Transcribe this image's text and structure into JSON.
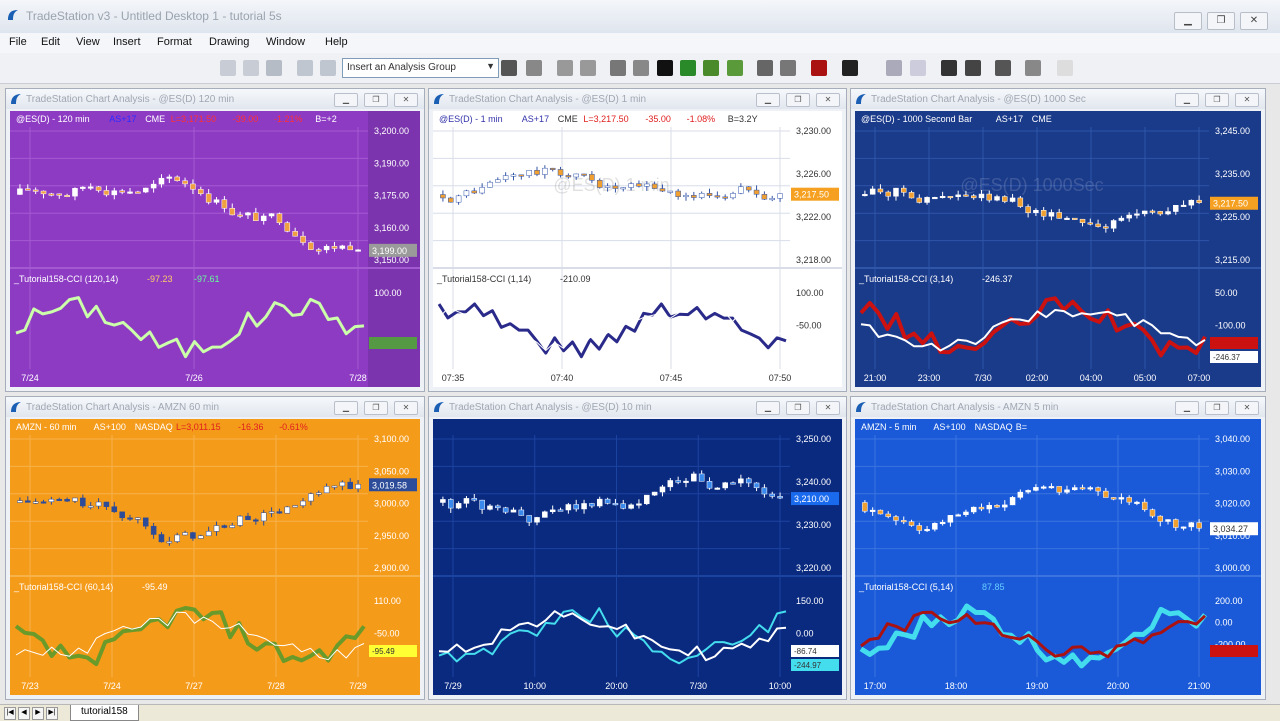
{
  "window": {
    "title": "TradeStation v3 - Untitled Desktop 1 - tutorial 5s"
  },
  "menu": [
    "File",
    "Edit",
    "View",
    "Insert",
    "Format",
    "Drawing",
    "Window",
    "Help"
  ],
  "toolbar": {
    "analysis_group": "Insert an Analysis Group"
  },
  "windows": [
    {
      "title": "TradeStation Chart Analysis - @ES(D) 120 min",
      "bg": "#8e3bc4",
      "panel": "#6b2a96",
      "axisbg": "#7b34ad",
      "fg": "#ffffff",
      "grid": "#a35ad0",
      "header": [
        {
          "t": "@ES(D) - 120 min",
          "c": "#ffffff"
        },
        {
          "t": "AS+17",
          "c": "#2b2bff"
        },
        {
          "t": "CME",
          "c": "#ffffff"
        },
        {
          "t": "L=3,171.50",
          "c": "#ff3030"
        },
        {
          "t": "-39.00",
          "c": "#ff3030"
        },
        {
          "t": "-1.21%",
          "c": "#ff3030"
        },
        {
          "t": "B=+2",
          "c": "#ffffff"
        }
      ],
      "yticks": [
        "3,200.00",
        "3,190.00",
        "3,175.00",
        "3,160.00",
        "3,150.00"
      ],
      "price_tags": [
        {
          "t": "3,199.00",
          "bg": "#9a9a9a",
          "c": "#ffffff"
        }
      ],
      "ind_label": "_Tutorial158-CCI (120,14)",
      "ind_values": [
        {
          "t": "-97.23",
          "c": "#ffcc66"
        },
        {
          "t": "-97.61",
          "c": "#66ff99"
        }
      ],
      "ind_ticks": [
        "100.00"
      ],
      "ind_tags": [
        {
          "t": "",
          "bg": "#559944",
          "c": "#ffffff"
        }
      ],
      "xticks": [
        "7/24",
        "7/26",
        "7/28"
      ],
      "candle_up": "#ffffff",
      "candle_dn": "#f0a040",
      "wick": "#ffffff",
      "lines": [
        {
          "color": "#ccffaa",
          "w": 3
        }
      ]
    },
    {
      "title": "TradeStation Chart Analysis - @ES(D) 1 min",
      "bg": "#ffffff",
      "panel": "#ffffff",
      "axisbg": "#ffffff",
      "fg": "#333333",
      "grid": "#d8dde8",
      "header": [
        {
          "t": "@ES(D) - 1 min",
          "c": "#3333aa"
        },
        {
          "t": "AS+17",
          "c": "#3333aa"
        },
        {
          "t": "CME",
          "c": "#333333"
        },
        {
          "t": "L=3,217.50",
          "c": "#e02020"
        },
        {
          "t": "-35.00",
          "c": "#e02020"
        },
        {
          "t": "-1.08%",
          "c": "#e02020"
        },
        {
          "t": "B=3.2Y",
          "c": "#333333"
        }
      ],
      "yticks": [
        "3,230.00",
        "3,226.00",
        "3,222.00",
        "3,218.00"
      ],
      "price_tags": [
        {
          "t": "3,217.50",
          "bg": "#f5a020",
          "c": "#ffffff"
        }
      ],
      "watermark": "@ES(D) 1 min",
      "ind_label": "_Tutorial158-CCI (1,14)",
      "ind_values": [
        {
          "t": "-210.09",
          "c": "#333333"
        }
      ],
      "ind_ticks": [
        "100.00",
        "-50.00"
      ],
      "ind_tags": [],
      "xticks": [
        "07:35",
        "07:40",
        "07:45",
        "07:50"
      ],
      "candle_up": "#ffffff",
      "candle_dn": "#f0a030",
      "wick": "#3355aa",
      "lines": [
        {
          "color": "#2a2a8a",
          "w": 3
        },
        {
          "color": "#ffffff",
          "w": 1
        }
      ]
    },
    {
      "title": "TradeStation Chart Analysis - @ES(D) 1000 Sec",
      "bg": "#1a3a8a",
      "panel": "#16307a",
      "axisbg": "#1a3a8a",
      "fg": "#ffffff",
      "grid": "#2f55a8",
      "header": [
        {
          "t": "@ES(D) - 1000 Second Bar",
          "c": "#ffffff"
        },
        {
          "t": "AS+17",
          "c": "#ffffff"
        },
        {
          "t": "CME",
          "c": "#ffffff"
        }
      ],
      "yticks": [
        "3,245.00",
        "3,235.00",
        "3,225.00",
        "3,215.00"
      ],
      "price_tags": [
        {
          "t": "3,217.50",
          "bg": "#f5a020",
          "c": "#ffffff"
        }
      ],
      "watermark": "@ES(D) 1000Sec",
      "ind_label": "_Tutorial158-CCI (3,14)",
      "ind_values": [
        {
          "t": "-246.37",
          "c": "#ffffff"
        }
      ],
      "ind_ticks": [
        "50.00",
        "-100.00"
      ],
      "ind_tags": [
        {
          "t": "",
          "bg": "#cc1111",
          "c": "#ffffff"
        },
        {
          "t": "-246.37",
          "bg": "#ffffff",
          "c": "#333333"
        }
      ],
      "xticks": [
        "21:00",
        "23:00",
        "7/30",
        "02:00",
        "04:00",
        "05:00",
        "07:00"
      ],
      "candle_up": "#ffffff",
      "candle_dn": "#f0a030",
      "wick": "#ffffff",
      "lines": [
        {
          "color": "#cc1111",
          "w": 4
        },
        {
          "color": "#ffffff",
          "w": 2
        }
      ]
    },
    {
      "title": "TradeStation Chart Analysis - AMZN 60 min",
      "bg": "#f59b1a",
      "panel": "#f5a020",
      "axisbg": "#f59b1a",
      "fg": "#ffffff",
      "grid": "#f7b24a",
      "header": [
        {
          "t": "AMZN - 60 min",
          "c": "#ffffff"
        },
        {
          "t": "AS+100",
          "c": "#ffffff"
        },
        {
          "t": "NASDAQ",
          "c": "#ffffff"
        },
        {
          "t": "L=3,011.15",
          "c": "#e02020"
        },
        {
          "t": "-16.36",
          "c": "#e02020"
        },
        {
          "t": "-0.61%",
          "c": "#e02020"
        }
      ],
      "yticks": [
        "3,100.00",
        "3,050.00",
        "3,000.00",
        "2,950.00",
        "2,900.00"
      ],
      "price_tags": [
        {
          "t": "3,019.58",
          "bg": "#2c4c99",
          "c": "#ffffff"
        }
      ],
      "ind_label": "_Tutorial158-CCI (60,14)",
      "ind_values": [
        {
          "t": "-95.49",
          "c": "#ffffff"
        }
      ],
      "ind_ticks": [
        "110.00",
        "-50.00"
      ],
      "ind_tags": [
        {
          "t": "-95.49",
          "bg": "#ffff33",
          "c": "#333333"
        }
      ],
      "xticks": [
        "7/23",
        "7/24",
        "7/27",
        "7/28",
        "7/29"
      ],
      "candle_up": "#ffffff",
      "candle_dn": "#2c4c99",
      "wick": "#2c4c99",
      "lines": [
        {
          "color": "#6a9a2a",
          "w": 4
        },
        {
          "color": "#ffffff",
          "w": 1
        }
      ]
    },
    {
      "title": "TradeStation Chart Analysis - @ES(D) 10 min",
      "bg": "#0a2a80",
      "panel": "#0a2a80",
      "axisbg": "#0a2a80",
      "fg": "#ffffff",
      "grid": "#1c43a0",
      "header": [],
      "yticks": [
        "3,250.00",
        "3,240.00",
        "3,230.00",
        "3,220.00"
      ],
      "price_tags": [
        {
          "t": "3,210.00",
          "bg": "#1a6aee",
          "c": "#ffffff"
        }
      ],
      "ind_label": "",
      "ind_values": [],
      "ind_ticks": [
        "150.00",
        "0.00"
      ],
      "ind_tags": [
        {
          "t": "-86.74",
          "bg": "#ffffff",
          "c": "#333333"
        },
        {
          "t": "-244.97",
          "bg": "#44ddee",
          "c": "#333333"
        }
      ],
      "xticks": [
        "7/29",
        "10:00",
        "20:00",
        "7/30",
        "10:00"
      ],
      "candle_up": "#ffffff",
      "candle_dn": "#3a8aee",
      "wick": "#ffffff",
      "lines": [
        {
          "color": "#44ddee",
          "w": 2
        },
        {
          "color": "#ffffff",
          "w": 2
        }
      ]
    },
    {
      "title": "TradeStation Chart Analysis - AMZN 5 min",
      "bg": "#1a5ad8",
      "panel": "#1a5ad8",
      "axisbg": "#1a5ad8",
      "fg": "#ffffff",
      "grid": "#3a74e0",
      "header": [
        {
          "t": "AMZN - 5 min",
          "c": "#ffffff"
        },
        {
          "t": "AS+100",
          "c": "#ffffff"
        },
        {
          "t": "NASDAQ",
          "c": "#ffffff"
        },
        {
          "t": "B=",
          "c": "#ffffff"
        }
      ],
      "yticks": [
        "3,040.00",
        "3,030.00",
        "3,020.00",
        "3,010.00",
        "3,000.00"
      ],
      "price_tags": [
        {
          "t": "3,034.27",
          "bg": "#ffffff",
          "c": "#333333"
        }
      ],
      "ind_label": "_Tutorial158-CCI (5,14)",
      "ind_values": [
        {
          "t": "87.85",
          "c": "#66ccff"
        }
      ],
      "ind_ticks": [
        "200.00",
        "0.00",
        "-200.00"
      ],
      "ind_tags": [
        {
          "t": "",
          "bg": "#cc1111",
          "c": "#ffffff"
        }
      ],
      "xticks": [
        "17:00",
        "18:00",
        "19:00",
        "20:00",
        "21:00"
      ],
      "candle_up": "#ffffff",
      "candle_dn": "#f0a030",
      "wick": "#ffffff",
      "lines": [
        {
          "color": "#44ddee",
          "w": 5
        },
        {
          "color": "#aa1111",
          "w": 3
        }
      ]
    }
  ],
  "status": {
    "tab": "tutorial158"
  }
}
